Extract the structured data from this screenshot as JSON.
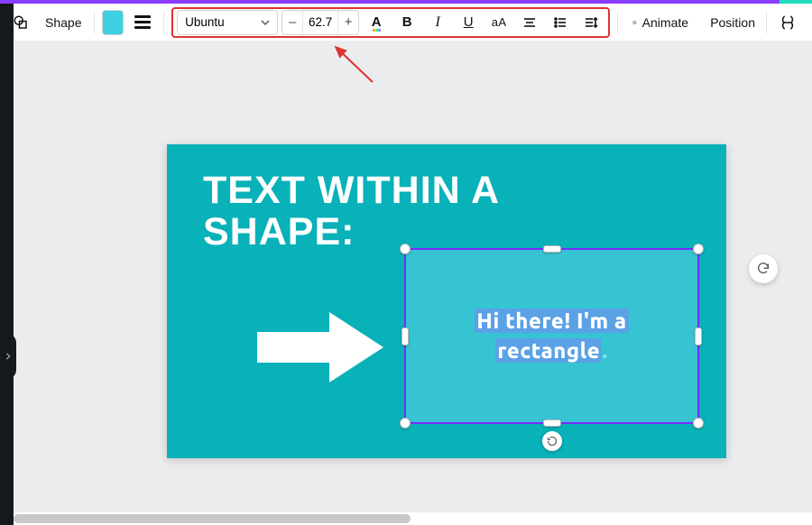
{
  "toolbar": {
    "shape_label": "Shape",
    "fill_color": "#3cd0e0",
    "font_name": "Ubuntu",
    "font_size": "62.7",
    "dec_label": "–",
    "inc_label": "+",
    "textcolor_label": "A",
    "bold_label": "B",
    "italic_label": "I",
    "underline_label": "U",
    "case_label": "aA",
    "animate_label": "Animate",
    "position_label": "Position"
  },
  "canvas": {
    "bg_color": "#09b1b9",
    "heading_line1": "TEXT WITHIN A",
    "heading_line2": "SHAPE:",
    "rect_fill": "#36c4d3",
    "rect_text_line1": "Hi there! I'm a",
    "rect_text_line2": "rectangle",
    "rect_text_dot": "."
  }
}
